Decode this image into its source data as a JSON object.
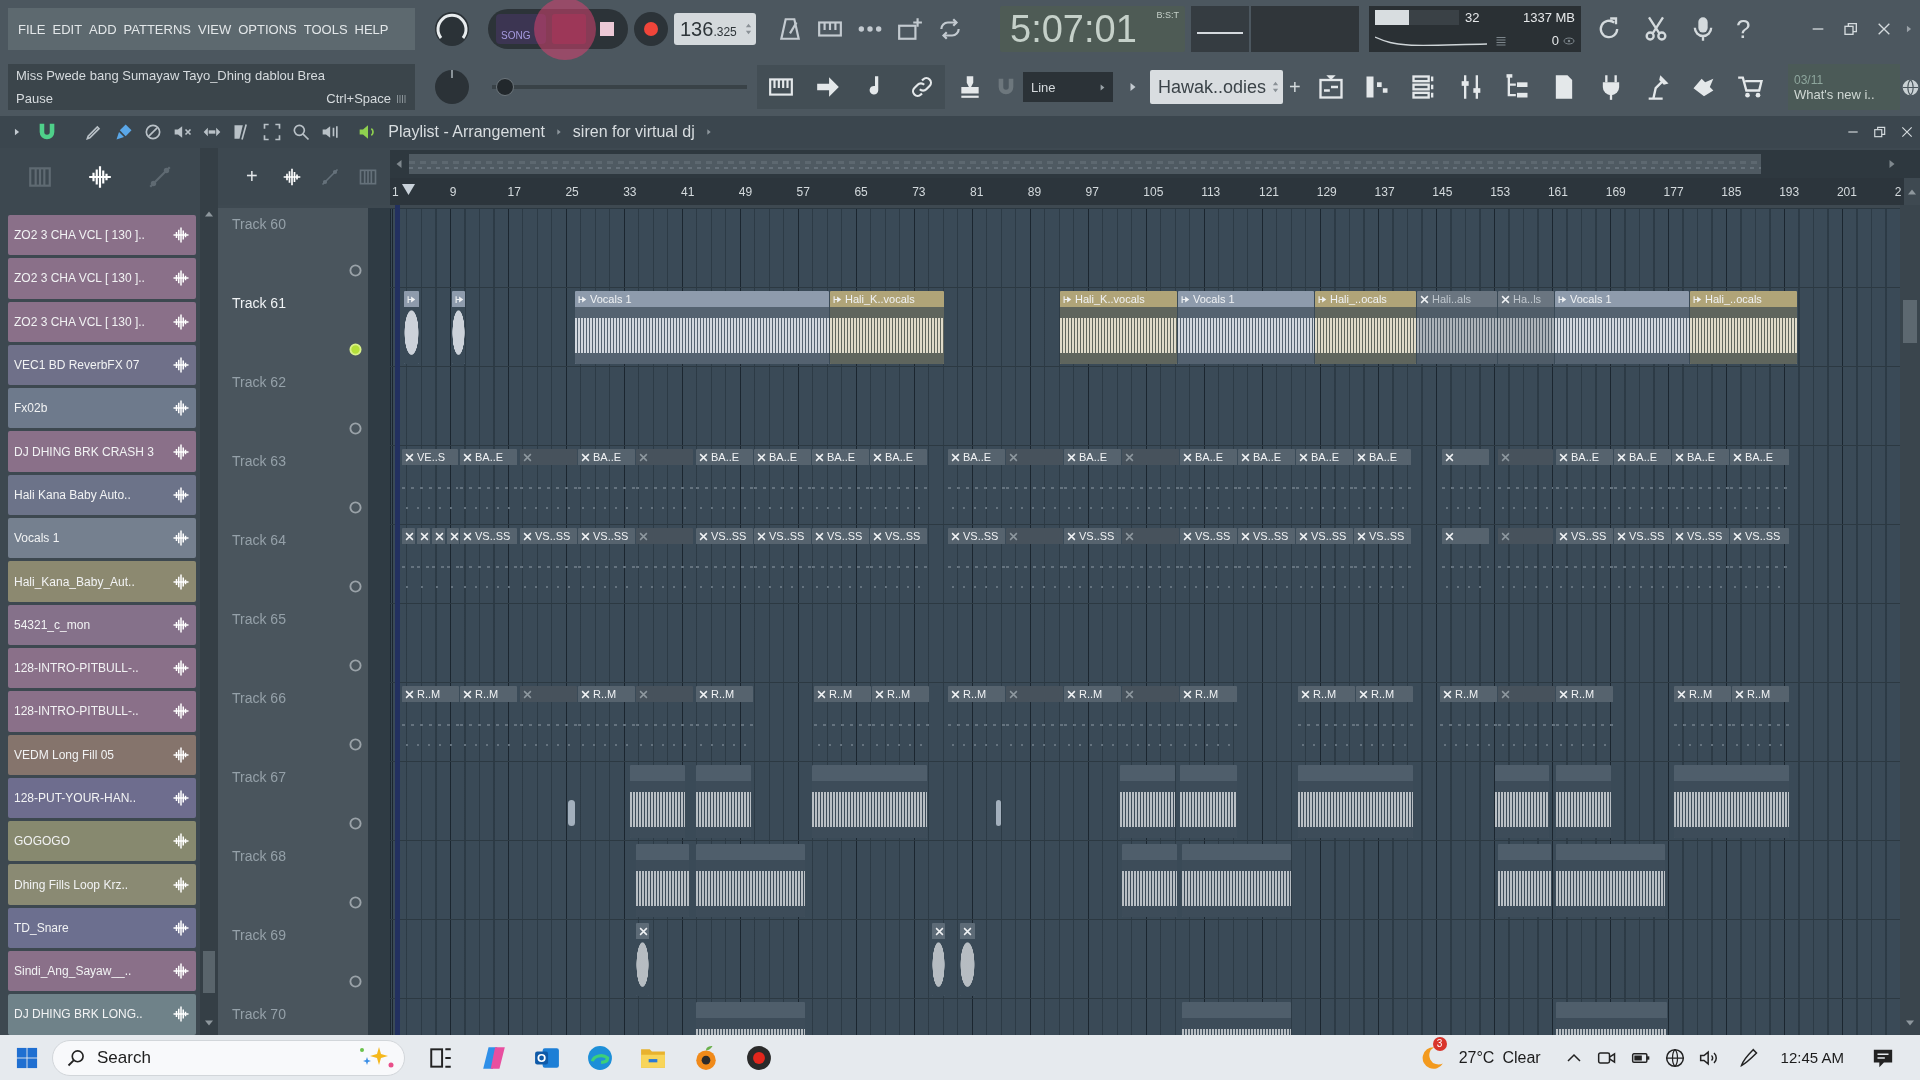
{
  "menu": {
    "items": [
      "FILE",
      "EDIT",
      "ADD",
      "PATTERNS",
      "VIEW",
      "OPTIONS",
      "TOOLS",
      "HELP"
    ]
  },
  "hint": {
    "title": "Miss Pwede bang Sumayaw Tayo_Dhing dablou Brea",
    "action": "Pause",
    "shortcut": "Ctrl+Space"
  },
  "transport": {
    "mode": {
      "label": "SONG",
      "selected": true
    },
    "tempo": "136",
    "tempo_fraction": ".325"
  },
  "time_display": {
    "value": "5:07:01",
    "format": "B:S:T"
  },
  "monitor": {
    "cpu": {
      "level": 0.4
    },
    "polyphony": "32",
    "memory": "1337 MB",
    "value": "0"
  },
  "help_button": "?",
  "pitch": {
    "level": 0.05
  },
  "snap": {
    "value": "Line"
  },
  "pattern_selector": {
    "value": "Hawak..odies",
    "add_label": "+"
  },
  "news": {
    "date": "03/11",
    "text": "What's new i.."
  },
  "playlist": {
    "tools": [
      {
        "kind": "pencil",
        "selected": false
      },
      {
        "kind": "brush",
        "selected": true
      },
      {
        "kind": "delete",
        "selected": false
      },
      {
        "kind": "mute",
        "selected": false
      },
      {
        "kind": "slip",
        "selected": false
      },
      {
        "kind": "slice",
        "selected": false
      },
      {
        "kind": "select",
        "selected": false
      },
      {
        "kind": "zoom",
        "selected": false
      },
      {
        "kind": "playback",
        "selected": false
      }
    ],
    "title": "Playlist - Arrangement",
    "arrangement": "siren for virtual dj",
    "source_tabs": [
      {
        "kind": "piano",
        "selected": false
      },
      {
        "kind": "audio",
        "selected": true
      },
      {
        "kind": "automation",
        "selected": false
      }
    ],
    "sources": [
      {
        "name": "ZO2 3 CHA VCL [ 130 ]..",
        "color": "#8a7089"
      },
      {
        "name": "ZO2 3 CHA VCL [ 130 ]..",
        "color": "#8a7089"
      },
      {
        "name": "ZO2 3 CHA VCL [ 130 ]..",
        "color": "#8a7089"
      },
      {
        "name": "VEC1 BD ReverbFX 07",
        "color": "#6f7089"
      },
      {
        "name": "Fx02b",
        "color": "#6e7a8c"
      },
      {
        "name": "DJ DHING BRK CRASH 3",
        "color": "#8a7089"
      },
      {
        "name": "Hali Kana Baby Auto..",
        "color": "#6c7389"
      },
      {
        "name": "Vocals 1",
        "color": "#75808f"
      },
      {
        "name": "Hali_Kana_Baby_Aut..",
        "color": "#8c8970"
      },
      {
        "name": "54321_c_mon",
        "color": "#85718a"
      },
      {
        "name": "128-INTRO-PITBULL-..",
        "color": "#8a7089"
      },
      {
        "name": "128-INTRO-PITBULL-..",
        "color": "#8a7089"
      },
      {
        "name": "VEDM Long Fill 05",
        "color": "#85746c"
      },
      {
        "name": "128-PUT-YOUR-HAN..",
        "color": "#6e6d8e"
      },
      {
        "name": "GOGOGO",
        "color": "#87896f"
      },
      {
        "name": "Dhing Fills Loop Krz..",
        "color": "#8a8a73"
      },
      {
        "name": "TD_Snare",
        "color": "#6c6f8f"
      },
      {
        "name": "Sindi_Ang_Sayaw__..",
        "color": "#8a7089"
      },
      {
        "name": "DJ DHING BRK LONG..",
        "color": "#6f8289"
      }
    ],
    "add_track_label": "+",
    "ruler": [
      "1",
      "9",
      "17",
      "25",
      "33",
      "41",
      "49",
      "57",
      "65",
      "73",
      "81",
      "89",
      "97",
      "105",
      "113",
      "121",
      "129",
      "137",
      "145",
      "153",
      "161",
      "169",
      "177",
      "185",
      "193",
      "201",
      "2"
    ],
    "tracks": [
      {
        "name": "Track 60",
        "selected": false
      },
      {
        "name": "Track 61",
        "selected": true,
        "clips": [
          {
            "kind": "oneshot",
            "muted": false,
            "color": "#8e9bac"
          },
          {
            "kind": "oneshot",
            "muted": false,
            "color": "#8e9bac"
          },
          {
            "kind": "audio",
            "label": "Vocals 1",
            "muted": false,
            "color": "#8e9bac"
          },
          {
            "kind": "audio",
            "label": "Hali_K..vocals",
            "muted": false,
            "color": "#b0a478"
          },
          {
            "kind": "audio",
            "label": "Hali_K..vocals",
            "muted": false,
            "color": "#b0a478"
          },
          {
            "kind": "audio",
            "label": "Vocals 1",
            "muted": false,
            "color": "#8e9bac"
          },
          {
            "kind": "audio",
            "label": "Hali_..ocals",
            "muted": false,
            "color": "#b0a478"
          },
          {
            "kind": "audio",
            "label": "Hali..als",
            "muted": true,
            "color": "#6a7580"
          },
          {
            "kind": "audio",
            "label": "Ha..ls",
            "muted": true,
            "color": "#6a7580"
          },
          {
            "kind": "audio",
            "label": "Vocals 1",
            "muted": false,
            "color": "#8e9bac"
          },
          {
            "kind": "audio",
            "label": "Hali_..ocals",
            "muted": false,
            "color": "#b0a478"
          }
        ]
      },
      {
        "name": "Track 62",
        "selected": false
      },
      {
        "name": "Track 63",
        "selected": false,
        "clips": [
          {
            "kind": "pattern",
            "label": "VE..S",
            "muted": false
          },
          {
            "kind": "pattern",
            "label": "BA..E",
            "muted": false
          },
          {
            "kind": "pattern",
            "muted": true
          },
          {
            "kind": "pattern",
            "label": "BA..E",
            "muted": false
          },
          {
            "kind": "pattern",
            "muted": true
          },
          {
            "kind": "pattern",
            "label": "BA..E",
            "muted": false
          },
          {
            "kind": "pattern",
            "label": "BA..E",
            "muted": false
          },
          {
            "kind": "pattern",
            "label": "BA..E",
            "muted": false
          },
          {
            "kind": "pattern",
            "label": "BA..E",
            "muted": false
          },
          {
            "kind": "pattern",
            "label": "BA..E",
            "muted": false
          },
          {
            "kind": "pattern",
            "muted": true
          },
          {
            "kind": "pattern",
            "label": "BA..E",
            "muted": false
          },
          {
            "kind": "pattern",
            "muted": true
          },
          {
            "kind": "pattern",
            "label": "BA..E",
            "muted": false
          },
          {
            "kind": "pattern",
            "label": "BA..E",
            "muted": false
          },
          {
            "kind": "pattern",
            "label": "BA..E",
            "muted": false
          },
          {
            "kind": "pattern",
            "label": "BA..E",
            "muted": false
          },
          {
            "kind": "pattern",
            "muted": false
          },
          {
            "kind": "pattern",
            "muted": true
          },
          {
            "kind": "pattern",
            "label": "BA..E",
            "muted": false
          },
          {
            "kind": "pattern",
            "label": "BA..E",
            "muted": false
          },
          {
            "kind": "pattern",
            "label": "BA..E",
            "muted": false
          },
          {
            "kind": "pattern",
            "label": "BA..E",
            "muted": false
          }
        ]
      },
      {
        "name": "Track 64",
        "selected": false,
        "clips": [
          {
            "kind": "pattern",
            "muted": false
          },
          {
            "kind": "pattern",
            "muted": false
          },
          {
            "kind": "pattern",
            "muted": false
          },
          {
            "kind": "pattern",
            "muted": false
          },
          {
            "kind": "pattern",
            "label": "VS..SS",
            "muted": false
          },
          {
            "kind": "pattern",
            "label": "VS..SS",
            "muted": false
          },
          {
            "kind": "pattern",
            "label": "VS..SS",
            "muted": false
          },
          {
            "kind": "pattern",
            "muted": true
          },
          {
            "kind": "pattern",
            "label": "VS..SS",
            "muted": false
          },
          {
            "kind": "pattern",
            "label": "VS..SS",
            "muted": false
          },
          {
            "kind": "pattern",
            "label": "VS..SS",
            "muted": false
          },
          {
            "kind": "pattern",
            "label": "VS..SS",
            "muted": false
          },
          {
            "kind": "pattern",
            "label": "VS..SS",
            "muted": false
          },
          {
            "kind": "pattern",
            "muted": true
          },
          {
            "kind": "pattern",
            "label": "VS..SS",
            "muted": false
          },
          {
            "kind": "pattern",
            "muted": true
          },
          {
            "kind": "pattern",
            "label": "VS..SS",
            "muted": false
          },
          {
            "kind": "pattern",
            "label": "VS..SS",
            "muted": false
          },
          {
            "kind": "pattern",
            "label": "VS..SS",
            "muted": false
          },
          {
            "kind": "pattern",
            "label": "VS..SS",
            "muted": false
          },
          {
            "kind": "pattern",
            "muted": false
          },
          {
            "kind": "pattern",
            "muted": true
          },
          {
            "kind": "pattern",
            "label": "VS..SS",
            "muted": false
          },
          {
            "kind": "pattern",
            "label": "VS..SS",
            "muted": false
          },
          {
            "kind": "pattern",
            "label": "VS..SS",
            "muted": false
          },
          {
            "kind": "pattern",
            "label": "VS..SS",
            "muted": false
          }
        ]
      },
      {
        "name": "Track 65",
        "selected": false
      },
      {
        "name": "Track 66",
        "selected": false,
        "clips": [
          {
            "kind": "pattern",
            "label": "R..M",
            "muted": false
          },
          {
            "kind": "pattern",
            "label": "R..M",
            "muted": false
          },
          {
            "kind": "pattern",
            "muted": true
          },
          {
            "kind": "pattern",
            "label": "R..M",
            "muted": false
          },
          {
            "kind": "pattern",
            "muted": true
          },
          {
            "kind": "pattern",
            "label": "R..M",
            "muted": false
          },
          {
            "kind": "pattern",
            "label": "R..M",
            "muted": false
          },
          {
            "kind": "pattern",
            "label": "R..M",
            "muted": false
          },
          {
            "kind": "pattern",
            "label": "R..M",
            "muted": false
          },
          {
            "kind": "pattern",
            "muted": true
          },
          {
            "kind": "pattern",
            "label": "R..M",
            "muted": false
          },
          {
            "kind": "pattern",
            "muted": true
          },
          {
            "kind": "pattern",
            "label": "R..M",
            "muted": false
          },
          {
            "kind": "pattern",
            "label": "R..M",
            "muted": false
          },
          {
            "kind": "pattern",
            "label": "R..M",
            "muted": false
          },
          {
            "kind": "pattern",
            "label": "R..M",
            "muted": false
          },
          {
            "kind": "pattern",
            "muted": true
          },
          {
            "kind": "pattern",
            "label": "R..M",
            "muted": false
          },
          {
            "kind": "pattern",
            "label": "R..M",
            "muted": false
          },
          {
            "kind": "pattern",
            "label": "R..M",
            "muted": false
          }
        ]
      },
      {
        "name": "Track 67",
        "selected": false,
        "clips": [
          {
            "kind": "hit",
            "color": "#a3b0bd"
          },
          {
            "kind": "audio",
            "muted": false,
            "color": "#4f5e6b"
          },
          {
            "kind": "audio",
            "muted": false,
            "color": "#4f5e6b"
          },
          {
            "kind": "audio",
            "muted": false,
            "color": "#4f5e6b"
          },
          {
            "kind": "hit",
            "color": "#a3b0bd"
          },
          {
            "kind": "audio",
            "muted": false,
            "color": "#4f5e6b"
          },
          {
            "kind": "audio",
            "muted": false,
            "color": "#4f5e6b"
          },
          {
            "kind": "audio",
            "muted": false,
            "color": "#4f5e6b"
          },
          {
            "kind": "audio",
            "muted": false,
            "color": "#4f5e6b"
          },
          {
            "kind": "audio",
            "muted": false,
            "color": "#4f5e6b"
          },
          {
            "kind": "audio",
            "muted": false,
            "color": "#4f5e6b"
          }
        ]
      },
      {
        "name": "Track 68",
        "selected": false,
        "clips": [
          {
            "kind": "audio",
            "muted": false,
            "color": "#4f5e6b"
          },
          {
            "kind": "audio",
            "muted": false,
            "color": "#4f5e6b"
          },
          {
            "kind": "audio",
            "muted": false,
            "color": "#4f5e6b"
          },
          {
            "kind": "audio",
            "muted": false,
            "color": "#4f5e6b"
          },
          {
            "kind": "audio",
            "muted": false,
            "color": "#4f5e6b"
          },
          {
            "kind": "audio",
            "muted": false,
            "color": "#4f5e6b"
          }
        ]
      },
      {
        "name": "Track 69",
        "selected": false,
        "clips": [
          {
            "kind": "oneshot",
            "muted": true,
            "color": "#5d6b77"
          },
          {
            "kind": "oneshot",
            "muted": true,
            "color": "#5d6b77"
          },
          {
            "kind": "oneshot",
            "muted": true,
            "color": "#5d6b77"
          }
        ]
      },
      {
        "name": "Track 70",
        "selected": false,
        "clips": [
          {
            "kind": "audio",
            "muted": false,
            "color": "#4f5e6b"
          },
          {
            "kind": "audio",
            "muted": false,
            "color": "#4f5e6b"
          },
          {
            "kind": "audio",
            "muted": false,
            "color": "#4f5e6b"
          }
        ]
      }
    ]
  },
  "taskbar": {
    "search": {
      "placeholder": "Search"
    },
    "weather": {
      "badge": "3",
      "temperature": "27°C",
      "condition": "Clear"
    },
    "clock": "12:45 AM"
  }
}
